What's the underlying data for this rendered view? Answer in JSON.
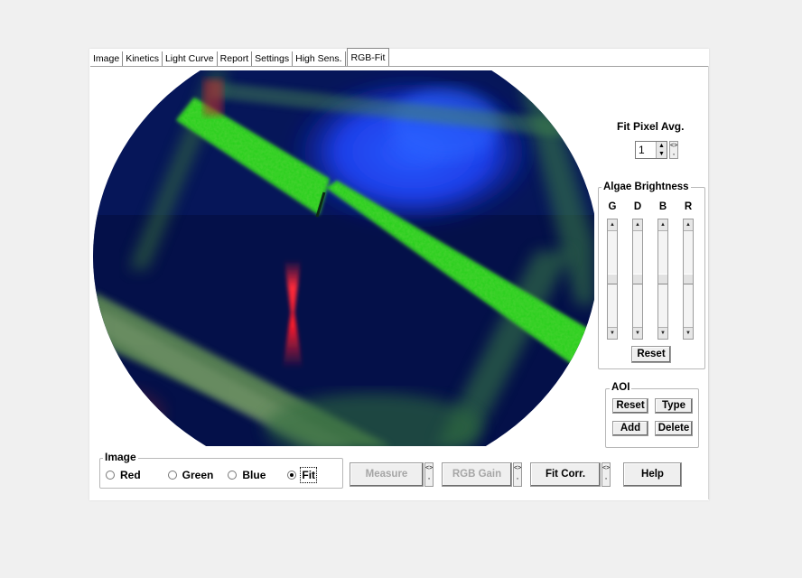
{
  "tabs": [
    "Image",
    "Kinetics",
    "Light Curve",
    "Report",
    "Settings",
    "High Sens.",
    "RGB-Fit"
  ],
  "active_tab": "RGB-Fit",
  "fit_pixel_avg": {
    "label": "Fit Pixel Avg.",
    "value": "1"
  },
  "algae_brightness": {
    "title": "Algae Brightness",
    "channels": [
      {
        "letter": "G",
        "level": 0.5
      },
      {
        "letter": "D",
        "level": 0.5
      },
      {
        "letter": "B",
        "level": 0.5
      },
      {
        "letter": "R",
        "level": 0.5
      }
    ],
    "reset_label": "Reset"
  },
  "aoi": {
    "title": "AOI",
    "reset_label": "Reset",
    "type_label": "Type",
    "add_label": "Add",
    "delete_label": "Delete"
  },
  "image_group": {
    "title": "Image",
    "options": [
      "Red",
      "Green",
      "Blue",
      "Fit"
    ],
    "selected": "Fit"
  },
  "buttons": {
    "measure": "Measure",
    "rgb_gain": "RGB Gain",
    "fit_corr": "Fit Corr.",
    "help": "Help"
  },
  "icons": {
    "spinner": "up-down-arrows-icon",
    "small_side": "small-options-icon"
  },
  "colors": {
    "fluorescence_green": "#3fd42a",
    "fluorescence_blue": "#1a3cff",
    "fluorescence_red": "#ff2030",
    "background_navy": "#04114f"
  }
}
